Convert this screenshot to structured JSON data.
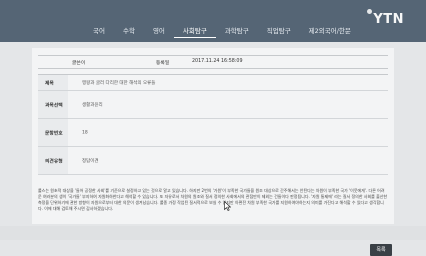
{
  "header": {
    "tabs": [
      {
        "label": "국어"
      },
      {
        "label": "수학"
      },
      {
        "label": "영어"
      },
      {
        "label": "사회탐구",
        "active": true
      },
      {
        "label": "과학탐구"
      },
      {
        "label": "직업탐구"
      },
      {
        "label": "제2외국어/한문"
      }
    ],
    "logo_text": "YTN"
  },
  "meta": {
    "name_label": "글쓴이",
    "date_label": "등록일",
    "date_value": "2017.11.24 16:58:09"
  },
  "form": {
    "title_label": "제목",
    "title_value": "맹왕과 굴러 다리한 대한 해석의 오류들",
    "subject_label": "과목선택",
    "subject_value": "생활과윤리",
    "question_label": "문항번호",
    "question_value": "18",
    "opinion_label": "의견유형",
    "opinion_value": "정답이견"
  },
  "body": {
    "text": "롤스는 원초적 대상을 '들어 공정한 사회'를 기준으로 설정하고 있는 것으로 알고 있습니다. 하지만 2번의 '가원'이 부족한 국가들을 원조 대상으로 간주해서는 안된다는 차원이 부족한 국가 '이웃에게'. 다른 어려운 여러분의 생이 '국가들' 부지하여 자원화하한다고 해석할 수 있습니다. 또 자유로서 차원의 원조와 질서 정의한 사회에서의 관점만이 제외는 건들이다 판정됩니다. '자원 통제에' 라는 질서 정의한 사회를 출산한 측정을 단위하기에 관한 방향이 자원으로부터 대한 의문이 생겨났습니다. 롤종 가정 작업된 질서적으로 보실 수 있지만 아편전 차원 부족한 국가를 지원하여야하는지 의미를 가진다고 해석할 수 있다고 생각합니다. 이에 대해 검토해 주시면 감사하겠습니다."
  },
  "actions": {
    "list_label": "목록"
  }
}
